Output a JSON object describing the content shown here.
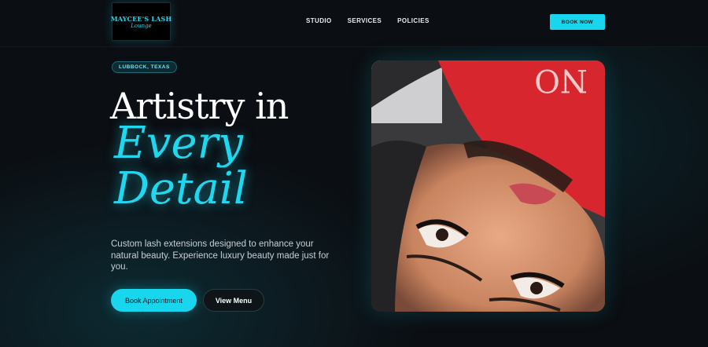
{
  "brand": {
    "logo_line1": "MAYCEE'S LASH",
    "logo_line2": "Lounge"
  },
  "nav": {
    "items": [
      {
        "label": "STUDIO"
      },
      {
        "label": "SERVICES"
      },
      {
        "label": "POLICIES"
      }
    ],
    "cta_label": "BOOK NOW"
  },
  "hero": {
    "location_badge": "LUBBOCK, TEXAS",
    "heading_line1": "Artistry in",
    "heading_script1": "Every",
    "heading_script2": "Detail",
    "description": "Custom lash extensions designed to enhance your natural beauty. Experience luxury beauty made just for you.",
    "primary_button": "Book Appointment",
    "secondary_button": "View Menu"
  },
  "colors": {
    "accent": "#18d6ee",
    "background": "#0b0e12",
    "shirt": "#d8262e"
  },
  "icons": {
    "photo": "client-lash-photo"
  }
}
